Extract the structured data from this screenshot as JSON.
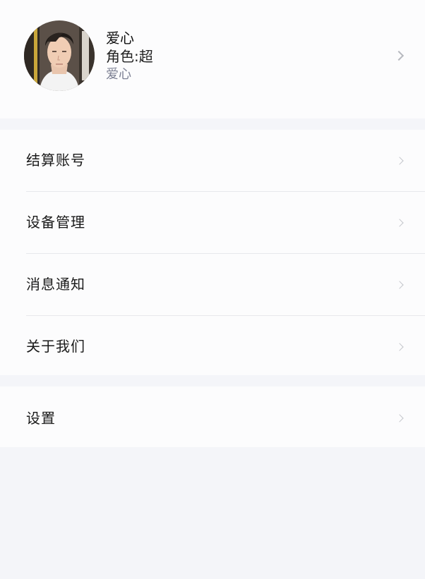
{
  "profile": {
    "name": "爱心",
    "role": "角色:超",
    "subtitle": "爱心"
  },
  "menu_group_1": {
    "items": [
      {
        "label": "结算账号"
      },
      {
        "label": "设备管理"
      },
      {
        "label": "消息通知"
      },
      {
        "label": "关于我们"
      }
    ]
  },
  "menu_group_2": {
    "items": [
      {
        "label": "设置"
      }
    ]
  },
  "icons": {
    "chevron": "chevron-right-icon"
  },
  "colors": {
    "background": "#f4f5f9",
    "card": "#fcfcfd",
    "subtitle": "#7d8194",
    "chevron": "#b7b9bf"
  }
}
